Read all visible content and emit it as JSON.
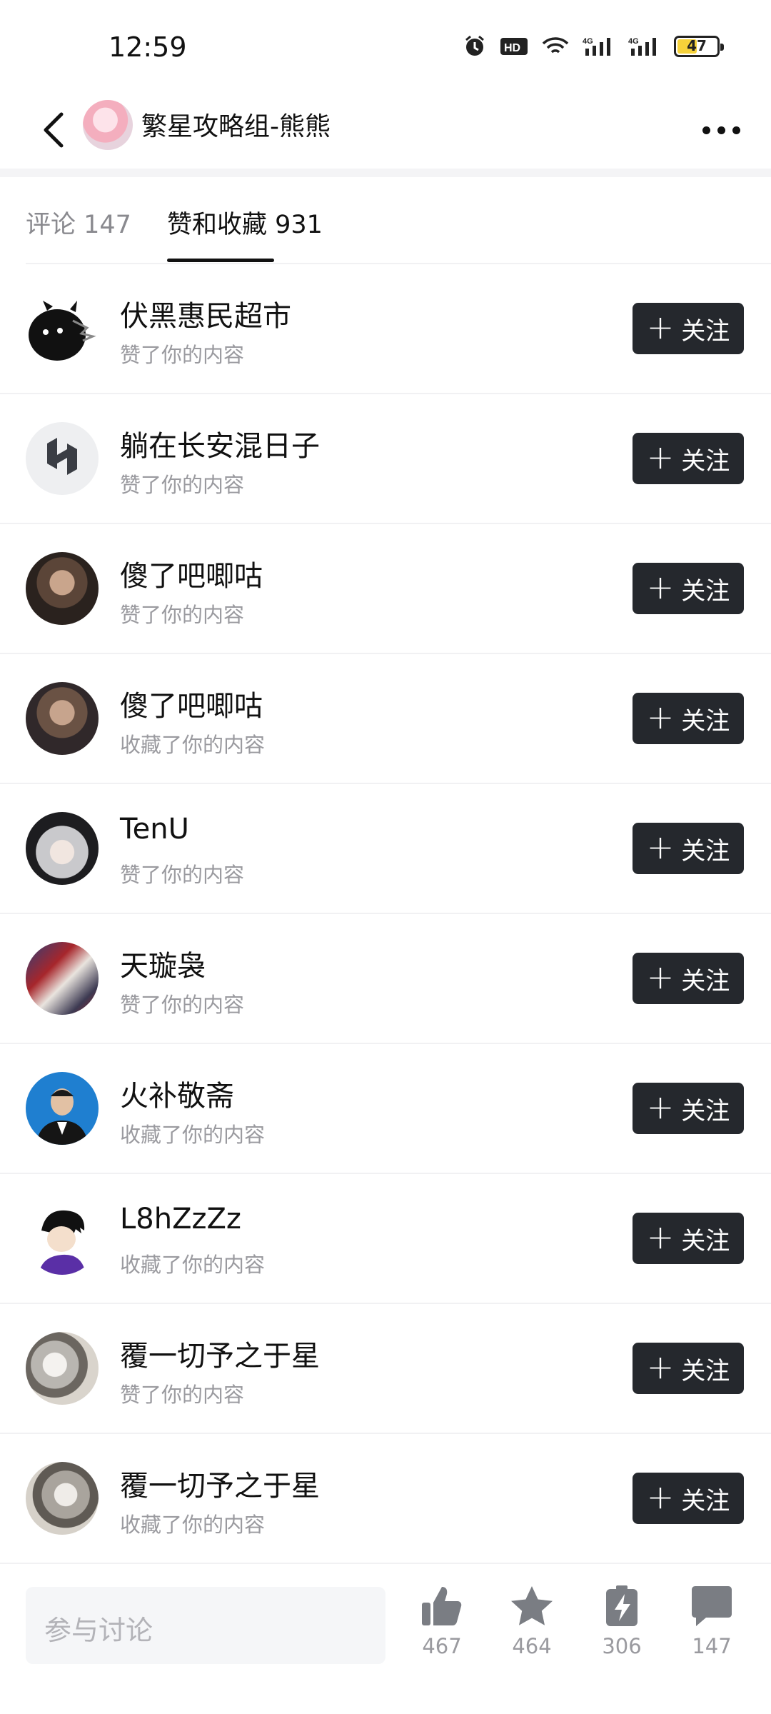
{
  "status_bar": {
    "time": "12:59",
    "battery_level": "47",
    "network_labels": [
      "HD",
      "4G",
      "4G"
    ]
  },
  "header": {
    "title": "繁星攻略组-熊熊"
  },
  "tabs": [
    {
      "label": "评论 147",
      "active": false
    },
    {
      "label": "赞和收藏 931",
      "active": true
    }
  ],
  "list": [
    {
      "name": "伏黑惠民超市",
      "action": "赞了你的内容",
      "button": "关注"
    },
    {
      "name": "躺在长安混日子",
      "action": "赞了你的内容",
      "button": "关注"
    },
    {
      "name": "傻了吧唧咕",
      "action": "赞了你的内容",
      "button": "关注"
    },
    {
      "name": "傻了吧唧咕",
      "action": "收藏了你的内容",
      "button": "关注"
    },
    {
      "name": "TenU",
      "action": "赞了你的内容",
      "button": "关注"
    },
    {
      "name": "天璇袅",
      "action": "赞了你的内容",
      "button": "关注"
    },
    {
      "name": "火补敬斋",
      "action": "收藏了你的内容",
      "button": "关注"
    },
    {
      "name": "L8hZzZz",
      "action": "收藏了你的内容",
      "button": "关注"
    },
    {
      "name": "覆一切予之于星",
      "action": "赞了你的内容",
      "button": "关注"
    },
    {
      "name": "覆一切予之于星",
      "action": "收藏了你的内容",
      "button": "关注"
    }
  ],
  "bottom_bar": {
    "input_placeholder": "参与讨论",
    "stats": [
      {
        "icon": "thumbs-up-icon",
        "count": "467"
      },
      {
        "icon": "star-icon",
        "count": "464"
      },
      {
        "icon": "battery-charge-icon",
        "count": "306"
      },
      {
        "icon": "comment-icon",
        "count": "147"
      }
    ]
  },
  "colors": {
    "follow_button_bg": "#25282d",
    "accent_text": "#111111",
    "muted_text": "#9a9a9f"
  }
}
